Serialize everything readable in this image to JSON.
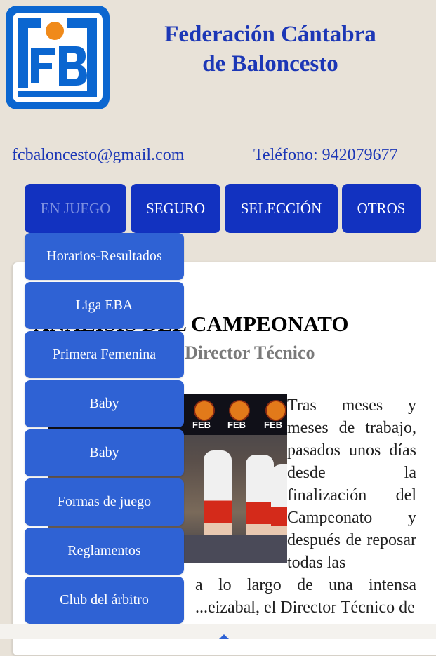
{
  "header": {
    "title_line1": "Federación Cántabra",
    "title_line2": "de Baloncesto",
    "logo_text": "FCB",
    "email": "fcbaloncesto@gmail.com",
    "phone": "Teléfono: 942079677"
  },
  "nav": {
    "tabs": [
      {
        "label": "EN JUEGO",
        "active": true
      },
      {
        "label": "SEGURO",
        "active": false
      },
      {
        "label": "SELECCIÓN",
        "active": false
      },
      {
        "label": "OTROS",
        "active": false
      }
    ]
  },
  "dropdown": {
    "items": [
      {
        "label": "Horarios-Resultados"
      },
      {
        "label": "Liga EBA"
      },
      {
        "label": "Primera Femenina"
      },
      {
        "label": "Baby"
      },
      {
        "label": "Baby"
      },
      {
        "label": "Formas de juego"
      },
      {
        "label": "Reglamentos"
      },
      {
        "label": "Club del árbitro"
      }
    ]
  },
  "article": {
    "title": "ANÁLISIS DEL CAMPEONATO",
    "subtitle": "Director Técnico",
    "photo_label": "FEB",
    "text_col": "Tras meses y meses de trabajo, pasados unos días desde la finalización del Campeonato y después de reposar todas las",
    "text_cont": "a lo largo de una intensa ...eizabal, el Director Técnico de"
  },
  "colors": {
    "accent": "#1232c0",
    "dropdown": "#2f62d4",
    "title": "#1c37b6",
    "background": "#e8e2d8"
  }
}
